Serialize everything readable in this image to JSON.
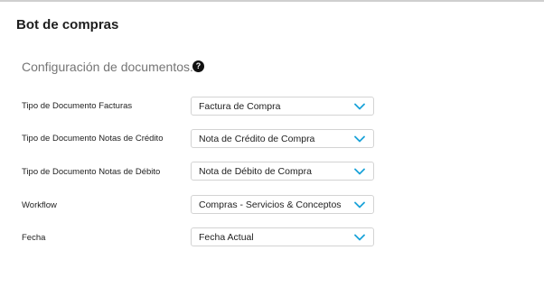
{
  "header": {
    "title": "Bot de compras"
  },
  "section": {
    "title": "Configuración de documentos.",
    "help_icon": "question-circle-icon"
  },
  "form": {
    "rows": [
      {
        "label": "Tipo de Documento Facturas",
        "value": "Factura de Compra"
      },
      {
        "label": "Tipo de Documento Notas de Crédito",
        "value": "Nota de Crédito de Compra"
      },
      {
        "label": "Tipo de Documento Notas de Débito",
        "value": "Nota de Débito de Compra"
      },
      {
        "label": "Workflow",
        "value": "Compras - Servicios & Conceptos"
      },
      {
        "label": "Fecha",
        "value": "Fecha Actual"
      }
    ]
  },
  "colors": {
    "accent": "#1aa3d9",
    "border": "#d3d3d3"
  }
}
